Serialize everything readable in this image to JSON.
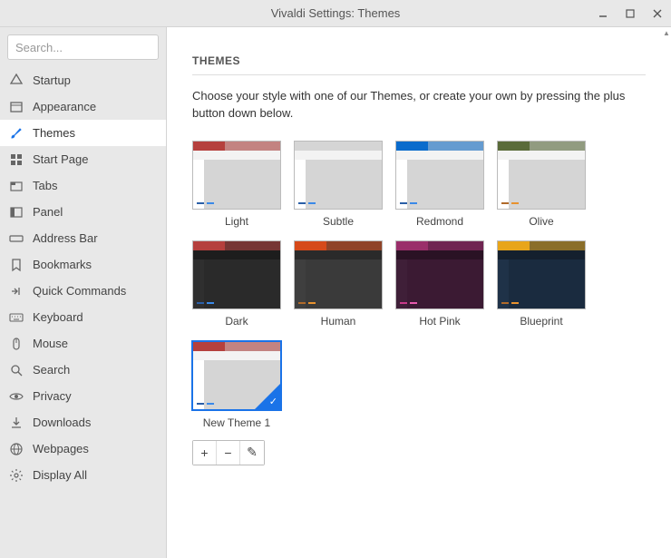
{
  "window": {
    "title": "Vivaldi Settings: Themes"
  },
  "search": {
    "placeholder": "Search..."
  },
  "sidebar": {
    "items": [
      {
        "label": "Startup",
        "icon": "vivaldi",
        "active": false
      },
      {
        "label": "Appearance",
        "icon": "appearance",
        "active": false
      },
      {
        "label": "Themes",
        "icon": "brush",
        "active": true
      },
      {
        "label": "Start Page",
        "icon": "grid",
        "active": false
      },
      {
        "label": "Tabs",
        "icon": "tabs",
        "active": false
      },
      {
        "label": "Panel",
        "icon": "panel",
        "active": false
      },
      {
        "label": "Address Bar",
        "icon": "addressbar",
        "active": false
      },
      {
        "label": "Bookmarks",
        "icon": "bookmark",
        "active": false
      },
      {
        "label": "Quick Commands",
        "icon": "quickcmd",
        "active": false
      },
      {
        "label": "Keyboard",
        "icon": "keyboard",
        "active": false
      },
      {
        "label": "Mouse",
        "icon": "mouse",
        "active": false
      },
      {
        "label": "Search",
        "icon": "search",
        "active": false
      },
      {
        "label": "Privacy",
        "icon": "eye",
        "active": false
      },
      {
        "label": "Downloads",
        "icon": "download",
        "active": false
      },
      {
        "label": "Webpages",
        "icon": "globe",
        "active": false
      },
      {
        "label": "Display All",
        "icon": "gear",
        "active": false
      }
    ]
  },
  "themes": {
    "heading": "THEMES",
    "description": "Choose your style with one of our Themes, or create your own by pressing the plus button down below.",
    "list": [
      {
        "name": "Light",
        "bg": "#d5d5d5",
        "header": "#b5403d",
        "tab": "#b5403d",
        "toolbar": "#f3f3f3",
        "panel": "#ffffff",
        "a1": "#2b5fa7",
        "a2": "#3a89e8",
        "selected": false
      },
      {
        "name": "Subtle",
        "bg": "#d5d5d5",
        "header": "#d5d5d5",
        "tab": "#d5d5d5",
        "toolbar": "#f3f3f3",
        "panel": "#ffffff",
        "a1": "#2b5fa7",
        "a2": "#3a89e8",
        "selected": false
      },
      {
        "name": "Redmond",
        "bg": "#d5d5d5",
        "header": "#0a6bcc",
        "tab": "#0a6bcc",
        "toolbar": "#f3f3f3",
        "panel": "#ffffff",
        "a1": "#2b5fa7",
        "a2": "#3a89e8",
        "selected": false
      },
      {
        "name": "Olive",
        "bg": "#d5d5d5",
        "header": "#5a6b3a",
        "tab": "#5a6b3a",
        "toolbar": "#f3f3f3",
        "panel": "#ffffff",
        "a1": "#b06a2a",
        "a2": "#e8922f",
        "selected": false
      },
      {
        "name": "Dark",
        "bg": "#2a2a2a",
        "header": "#b5403d",
        "tab": "#b5403d",
        "toolbar": "#1d1d1d",
        "panel": "#2f2f2f",
        "a1": "#2b5fa7",
        "a2": "#3a89e8",
        "selected": false
      },
      {
        "name": "Human",
        "bg": "#3a3a3a",
        "header": "#d64a1a",
        "tab": "#d64a1a",
        "toolbar": "#2a2a2a",
        "panel": "#3f3f3f",
        "a1": "#b06a2a",
        "a2": "#e8922f",
        "selected": false
      },
      {
        "name": "Hot Pink",
        "bg": "#3b1a33",
        "header": "#9a2f6a",
        "tab": "#9a2f6a",
        "toolbar": "#2a1224",
        "panel": "#3f1f38",
        "a1": "#c93a8a",
        "a2": "#e85aae",
        "selected": false
      },
      {
        "name": "Blueprint",
        "bg": "#1a2b3f",
        "header": "#e8a51a",
        "tab": "#e8a51a",
        "toolbar": "#14202e",
        "panel": "#1f3248",
        "a1": "#b06a2a",
        "a2": "#e8922f",
        "selected": false
      },
      {
        "name": "New Theme 1",
        "bg": "#d5d5d5",
        "header": "#b5403d",
        "tab": "#b5403d",
        "toolbar": "#f3f3f3",
        "panel": "#ffffff",
        "a1": "#2b5fa7",
        "a2": "#3a89e8",
        "selected": true
      }
    ]
  },
  "toolbar": {
    "add": "+",
    "remove": "−",
    "edit": "✎"
  }
}
